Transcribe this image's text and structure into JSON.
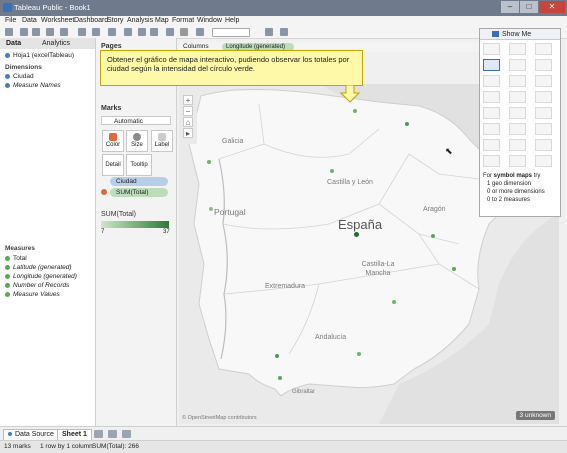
{
  "window": {
    "title": "Tableau Public - Book1"
  },
  "menu": {
    "items": [
      "File",
      "Data",
      "Worksheet",
      "Dashboard",
      "Story",
      "Analysis",
      "Map",
      "Format",
      "Window",
      "Help"
    ]
  },
  "left_panel": {
    "tabs": {
      "data": "Data",
      "analytics": "Analytics"
    },
    "datasource": "Hoja1 (excelTableau)",
    "dimensions_header": "Dimensions",
    "dimensions": [
      "Ciudad",
      "Measure Names"
    ],
    "measures_header": "Measures",
    "measures": [
      "Total",
      "Latitude (generated)",
      "Longitude (generated)",
      "Number of Records",
      "Measure Values"
    ]
  },
  "shelves": {
    "pages_label": "Pages",
    "columns_label": "Columns",
    "columns_pill": "Longitude (generated)",
    "marks_label": "Marks",
    "mark_type": "Automatic",
    "buttons": {
      "color": "Color",
      "size": "Size",
      "label": "Label",
      "detail": "Detail",
      "tooltip": "Tooltip"
    },
    "pills": {
      "ciudad": "Ciudad",
      "sum_total": "SUM(Total)"
    },
    "legend_title": "SUM(Total)",
    "legend_min": "7",
    "legend_max": "37"
  },
  "callout": {
    "text": "Obtener el gráfico de mapa interactivo, pudiendo observar los totales por ciudad según la intensidad del círculo verde."
  },
  "map": {
    "labels": {
      "galicia": "Galicia",
      "castilla_leon": "Castilla y León",
      "portugal": "Portugal",
      "espana": "España",
      "aragon": "Aragón",
      "castilla_mancha": "Castilla-La Mancha",
      "extremadura": "Extremadura",
      "andalucia": "Andalucía",
      "gibraltar": "Gibraltar"
    },
    "attribution": "© OpenStreetMap contributors",
    "unknown_badge": "3 unknown"
  },
  "show_me": {
    "title": "Show Me",
    "hint_intro": "For",
    "hint_keyword": "symbol maps",
    "hint_suffix": "try",
    "hint_lines": [
      "1 geo dimension",
      "0 or more dimensions",
      "0 to 2 measures"
    ]
  },
  "sheet_tabs": {
    "data_source": "Data Source",
    "sheet1": "Sheet 1"
  },
  "status": {
    "marks": "13 marks",
    "rows": "1 row by 1 column",
    "sum": "SUM(Total): 266"
  },
  "colors": {
    "accent": "#3b6fb6",
    "marker": "#4f9a52",
    "callout_bg": "#fdf9a8"
  }
}
